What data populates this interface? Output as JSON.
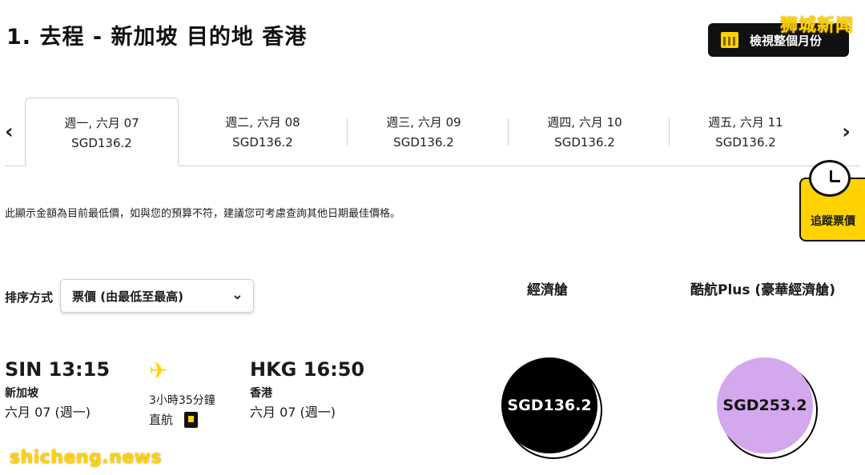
{
  "header": {
    "title": "1. 去程 - 新加坡 目的地 香港",
    "month_view_label": "檢視整個月份"
  },
  "watermarks": {
    "top": "狮城新闻",
    "bottom": "shicheng.news"
  },
  "date_strip": {
    "tabs": [
      {
        "day": "週一, 六月 07",
        "price": "SGD136.2"
      },
      {
        "day": "週二, 六月 08",
        "price": "SGD136.2"
      },
      {
        "day": "週三, 六月 09",
        "price": "SGD136.2"
      },
      {
        "day": "週四, 六月 10",
        "price": "SGD136.2"
      },
      {
        "day": "週五, 六月 11",
        "price": "SGD136.2"
      }
    ]
  },
  "tracker": {
    "label": "追蹤票價"
  },
  "notice": "此顯示金額為目前最低價，如與您的預算不符，建議您可考慮查詢其他日期最佳價格。",
  "sort": {
    "label": "排序方式",
    "selected": "票價 (由最低至最高)"
  },
  "fare_columns": {
    "economy": "經濟艙",
    "plus": "酷航Plus (豪華經濟艙)"
  },
  "flight": {
    "departure": {
      "time": "SIN 13:15",
      "city": "新加坡",
      "date": "六月 07 (週一)"
    },
    "arrival": {
      "time": "HKG 16:50",
      "city": "香港",
      "date": "六月 07 (週一)"
    },
    "duration": "3小時35分鐘",
    "type": "直航",
    "economy_fare": "SGD136.2",
    "plus_fare": "SGD253.2"
  },
  "icons": {
    "calendar": "calendar-icon",
    "prev": "chevron-left-icon",
    "next": "chevron-right-icon",
    "plane": "plane-icon",
    "dropdown": "chevron-down-icon",
    "document": "document-icon"
  },
  "colors": {
    "accent": "#ffd200",
    "plus_fare": "#d4a8ec",
    "economy_fare": "#000000"
  }
}
